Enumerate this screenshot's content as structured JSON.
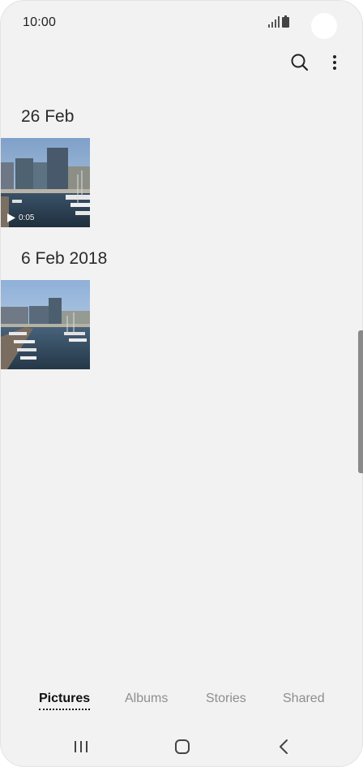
{
  "status_bar": {
    "time": "10:00",
    "signal_icon": "signal-icon",
    "battery_icon": "battery-icon"
  },
  "toolbar": {
    "search_icon": "search-icon",
    "more_icon": "more-options-icon"
  },
  "sections": [
    {
      "date": "26 Feb",
      "items": [
        {
          "type": "video",
          "duration": "0:05"
        }
      ]
    },
    {
      "date": "6 Feb 2018",
      "items": [
        {
          "type": "photo"
        }
      ]
    }
  ],
  "tabs": [
    {
      "label": "Pictures",
      "active": true
    },
    {
      "label": "Albums",
      "active": false
    },
    {
      "label": "Stories",
      "active": false
    },
    {
      "label": "Shared",
      "active": false
    }
  ],
  "nav_bar": {
    "recents_icon": "recents-icon",
    "home_icon": "home-icon",
    "back_icon": "back-icon"
  },
  "colors": {
    "background": "#f2f2f2",
    "text_primary": "#2a2a2a",
    "tab_inactive": "#8e8e8e",
    "tab_active": "#111111"
  }
}
